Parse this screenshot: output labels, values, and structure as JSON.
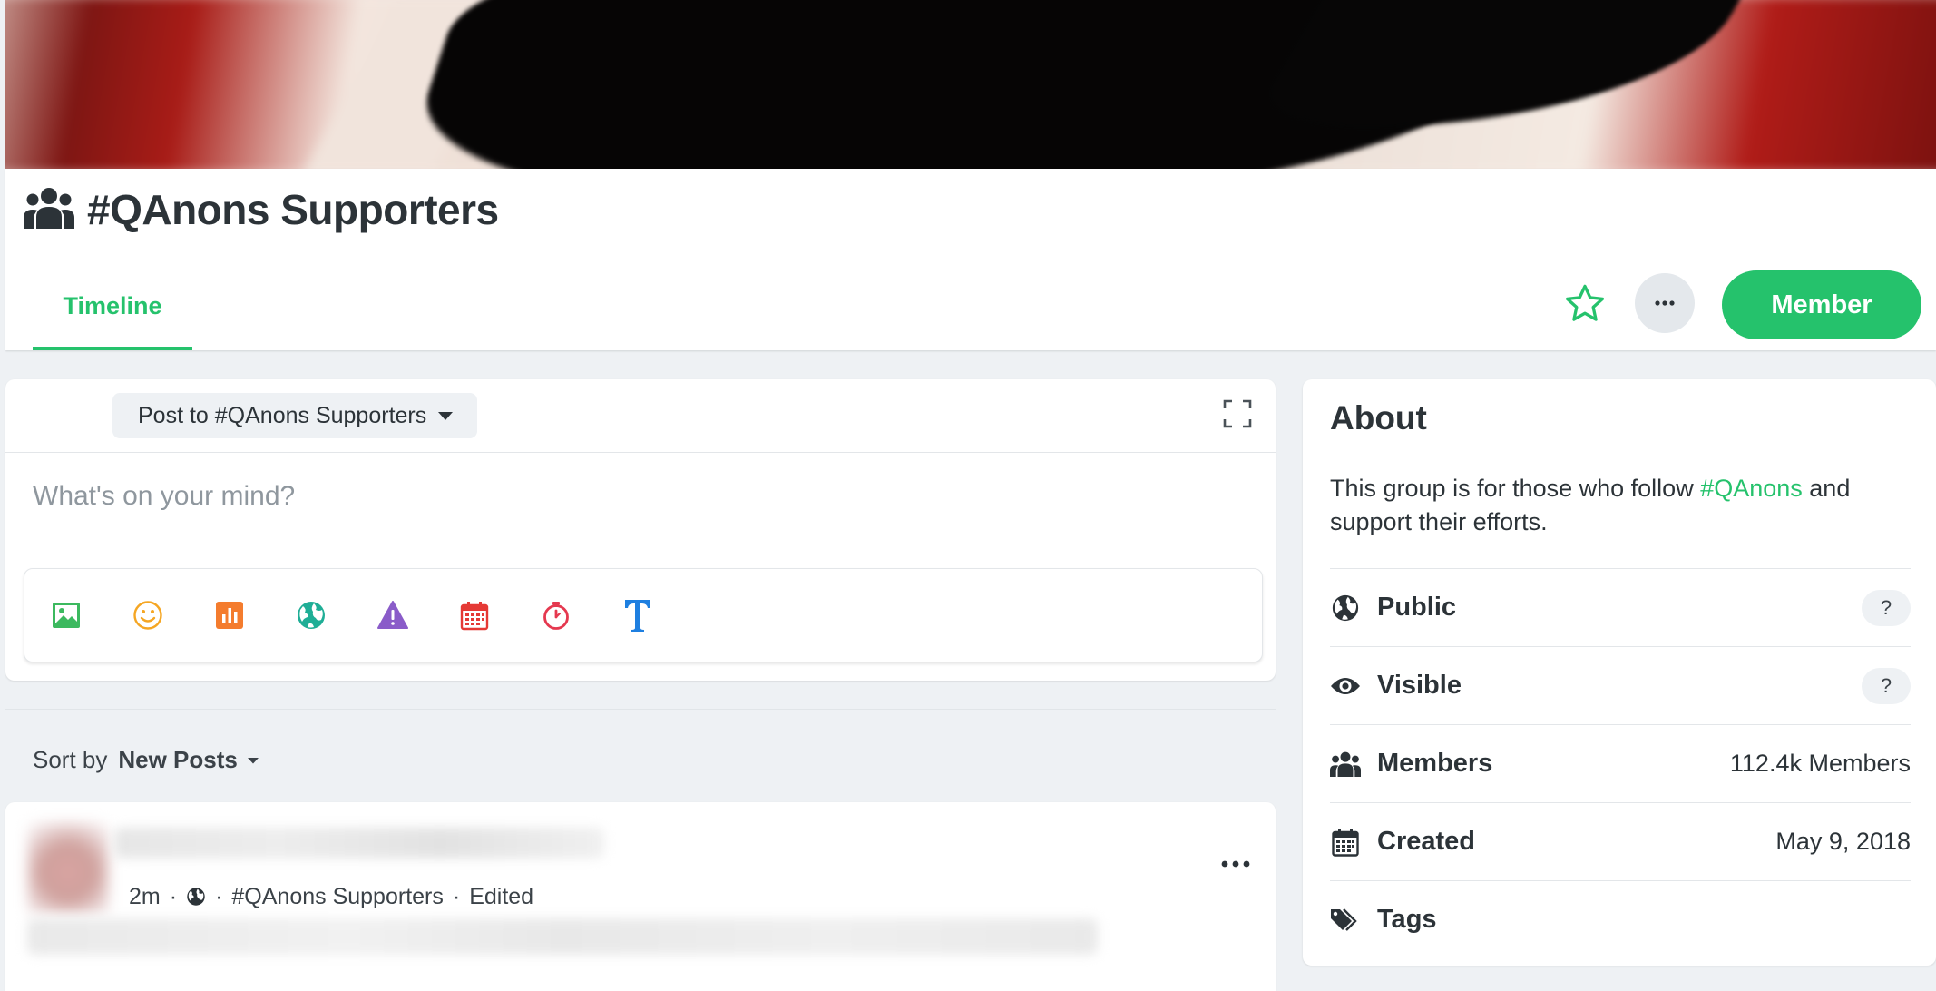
{
  "group": {
    "title": "#QAnons Supporters",
    "tabs": [
      {
        "label": "Timeline",
        "active": true
      }
    ],
    "member_button": "Member",
    "accent_color": "#25c26c"
  },
  "composer": {
    "post_to_label": "Post to #QAnons Supporters",
    "placeholder": "What's on your mind?",
    "tools": [
      "image-icon",
      "emoji-icon",
      "poll-icon",
      "globe-icon",
      "warning-icon",
      "calendar-icon",
      "timer-icon",
      "text-format-icon"
    ]
  },
  "sort": {
    "label": "Sort by",
    "value": "New Posts"
  },
  "post": {
    "time": "2m",
    "group": "#QAnons Supporters",
    "edited": "Edited",
    "separator": "·"
  },
  "about": {
    "title": "About",
    "description_prefix": "This group is for those who follow ",
    "description_link": "#QAnons",
    "description_suffix": " and support their efforts.",
    "rows": [
      {
        "label": "Public",
        "value": "?",
        "icon": "globe-icon"
      },
      {
        "label": "Visible",
        "value": "?",
        "icon": "eye-icon"
      },
      {
        "label": "Members",
        "value": "112.4k Members",
        "icon": "users-icon"
      },
      {
        "label": "Created",
        "value": "May 9, 2018",
        "icon": "calendar-icon"
      },
      {
        "label": "Tags",
        "value": "",
        "icon": "tag-icon"
      }
    ]
  }
}
